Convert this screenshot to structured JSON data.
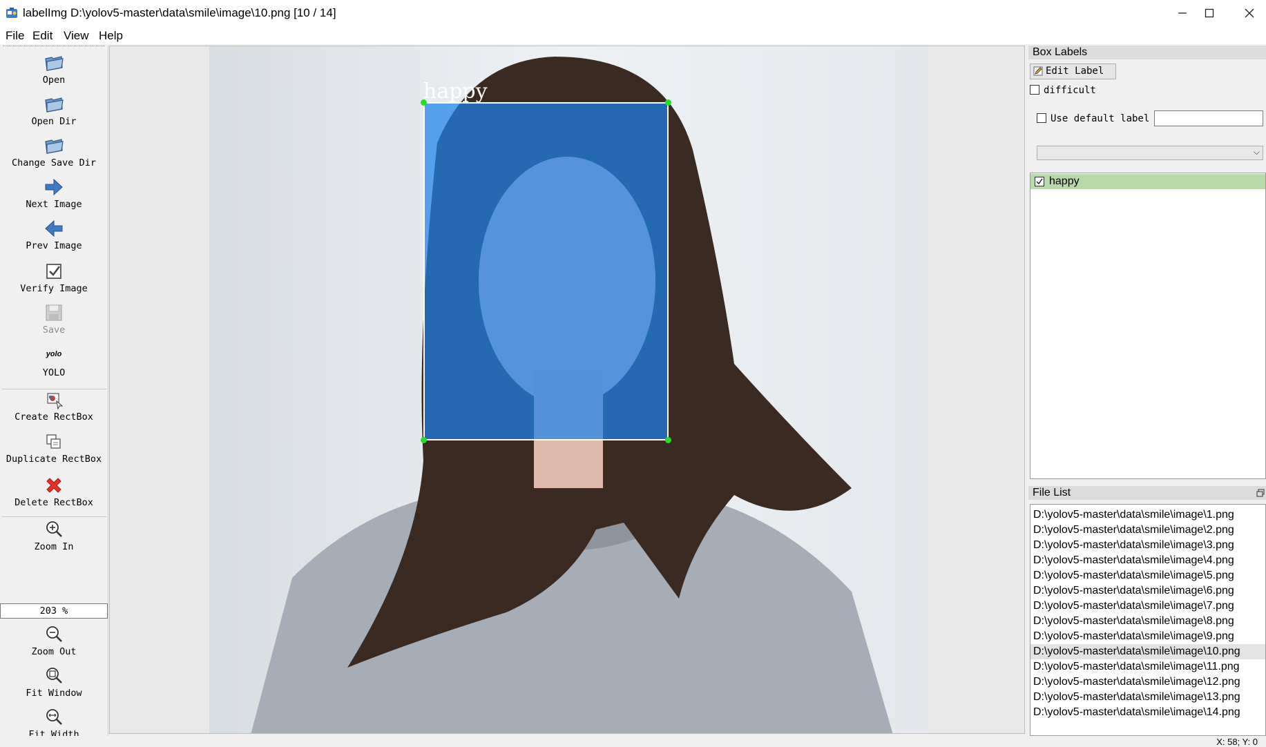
{
  "window": {
    "title": "labelImg D:\\yolov5-master\\data\\smile\\image\\10.png [10 / 14]",
    "minimize_icon": "minimize-icon",
    "maximize_icon": "maximize-icon",
    "close_icon": "close-icon"
  },
  "menu": {
    "items": [
      "File",
      "Edit",
      "View",
      "Help"
    ]
  },
  "toolbar": {
    "tools": [
      {
        "label": "Open",
        "icon": "open-folder-icon"
      },
      {
        "label": "Open Dir",
        "icon": "open-folder-icon"
      },
      {
        "label": "Change Save Dir",
        "icon": "open-folder-icon"
      },
      {
        "label": "Next Image",
        "icon": "arrow-right-icon"
      },
      {
        "label": "Prev Image",
        "icon": "arrow-left-icon"
      },
      {
        "label": "Verify Image",
        "icon": "verify-checkbox-icon"
      },
      {
        "label": "Save",
        "icon": "save-icon",
        "disabled": true
      },
      {
        "label": "YOLO",
        "icon": "yolo-format-icon",
        "icon_text": "yolo"
      },
      {
        "label": "Create RectBox",
        "icon": "create-rectbox-icon"
      },
      {
        "label": "Duplicate RectBox",
        "icon": "duplicate-icon"
      },
      {
        "label": "Delete RectBox",
        "icon": "delete-x-icon"
      },
      {
        "label": "Zoom In",
        "icon": "zoom-in-icon"
      },
      {
        "label": "Zoom Out",
        "icon": "zoom-out-icon"
      },
      {
        "label": "Fit Window",
        "icon": "fit-window-icon"
      },
      {
        "label": "Fit Width",
        "icon": "fit-width-icon"
      }
    ],
    "zoom_value": "203 %"
  },
  "canvas": {
    "box_label": "happy",
    "box_color": "#1e82eb",
    "handle_color": "#20e020"
  },
  "box_labels": {
    "title": "Box Labels",
    "edit_label": "Edit Label",
    "difficult": "difficult",
    "use_default_label": "Use default label",
    "default_label_value": "",
    "combo_value": "",
    "labels": [
      {
        "name": "happy",
        "checked": true
      }
    ],
    "selected_color": "#b7d9a9"
  },
  "file_list": {
    "title": "File List",
    "files": [
      "D:\\yolov5-master\\data\\smile\\image\\1.png",
      "D:\\yolov5-master\\data\\smile\\image\\2.png",
      "D:\\yolov5-master\\data\\smile\\image\\3.png",
      "D:\\yolov5-master\\data\\smile\\image\\4.png",
      "D:\\yolov5-master\\data\\smile\\image\\5.png",
      "D:\\yolov5-master\\data\\smile\\image\\6.png",
      "D:\\yolov5-master\\data\\smile\\image\\7.png",
      "D:\\yolov5-master\\data\\smile\\image\\8.png",
      "D:\\yolov5-master\\data\\smile\\image\\9.png",
      "D:\\yolov5-master\\data\\smile\\image\\10.png",
      "D:\\yolov5-master\\data\\smile\\image\\11.png",
      "D:\\yolov5-master\\data\\smile\\image\\12.png",
      "D:\\yolov5-master\\data\\smile\\image\\13.png",
      "D:\\yolov5-master\\data\\smile\\image\\14.png"
    ],
    "selected_index": 9
  },
  "status": {
    "text": "X: 58; Y: 0"
  }
}
